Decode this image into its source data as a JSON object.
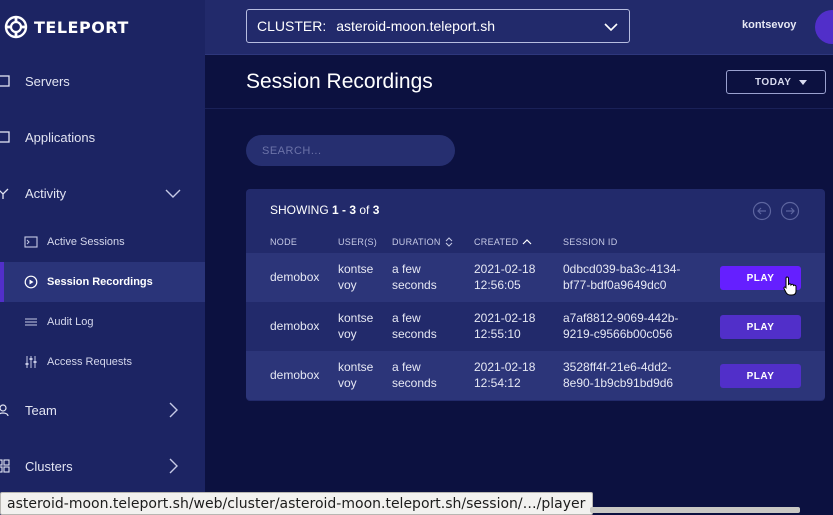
{
  "brand": {
    "name": "TELEPORT",
    "icon": "teleport-logo-icon"
  },
  "sidebar": {
    "items": [
      {
        "label": "Servers",
        "icon": "server-icon"
      },
      {
        "label": "Applications",
        "icon": "application-icon"
      },
      {
        "label": "Activity",
        "icon": "activity-icon",
        "expanded": true
      },
      {
        "label": "Team",
        "icon": "user-icon"
      },
      {
        "label": "Clusters",
        "icon": "cluster-icon"
      }
    ],
    "activity_sub": [
      {
        "label": "Active Sessions",
        "icon": "terminal-icon"
      },
      {
        "label": "Session Recordings",
        "icon": "play-circle-icon",
        "active": true
      },
      {
        "label": "Audit Log",
        "icon": "list-icon"
      },
      {
        "label": "Access Requests",
        "icon": "sliders-icon"
      }
    ]
  },
  "topbar": {
    "cluster_prefix": "CLUSTER:",
    "cluster_value": "asteroid-moon.teleport.sh",
    "username": "kontsevoy"
  },
  "main": {
    "title": "Session Recordings",
    "range_label": "TODAY",
    "search_placeholder": "SEARCH..."
  },
  "table": {
    "showing_prefix": "SHOWING ",
    "showing_range": "1 - 3",
    "showing_of": " of ",
    "showing_total": "3",
    "headers": {
      "node": "NODE",
      "users": "USER(S)",
      "duration": "DURATION",
      "created": "CREATED",
      "session_id": "SESSION ID"
    },
    "rows": [
      {
        "node": "demobox",
        "user_1": "kontse",
        "user_2": "voy",
        "duration_1": "a few",
        "duration_2": "seconds",
        "created_1": "2021-02-18",
        "created_2": "12:56:05",
        "sid_1": "0dbcd039-ba3c-4134-",
        "sid_2": "bf77-bdf0a9649dc0",
        "action": "PLAY"
      },
      {
        "node": "demobox",
        "user_1": "kontse",
        "user_2": "voy",
        "duration_1": "a few",
        "duration_2": "seconds",
        "created_1": "2021-02-18",
        "created_2": "12:55:10",
        "sid_1": "a7af8812-9069-442b-",
        "sid_2": "9219-c9566b00c056",
        "action": "PLAY"
      },
      {
        "node": "demobox",
        "user_1": "kontse",
        "user_2": "voy",
        "duration_1": "a few",
        "duration_2": "seconds",
        "created_1": "2021-02-18",
        "created_2": "12:54:12",
        "sid_1": "3528ff4f-21e6-4dd2-",
        "sid_2": "8e90-1b9cb91bd9d6",
        "action": "PLAY"
      }
    ]
  },
  "status_bar": {
    "url": "asteroid-moon.teleport.sh/web/cluster/asteroid-moon.teleport.sh/session/…/player"
  },
  "colors": {
    "sidebar_bg": "#1c2463",
    "main_bg": "#0c1140",
    "accent": "#512fc9",
    "card_bg": "#222a6b"
  }
}
